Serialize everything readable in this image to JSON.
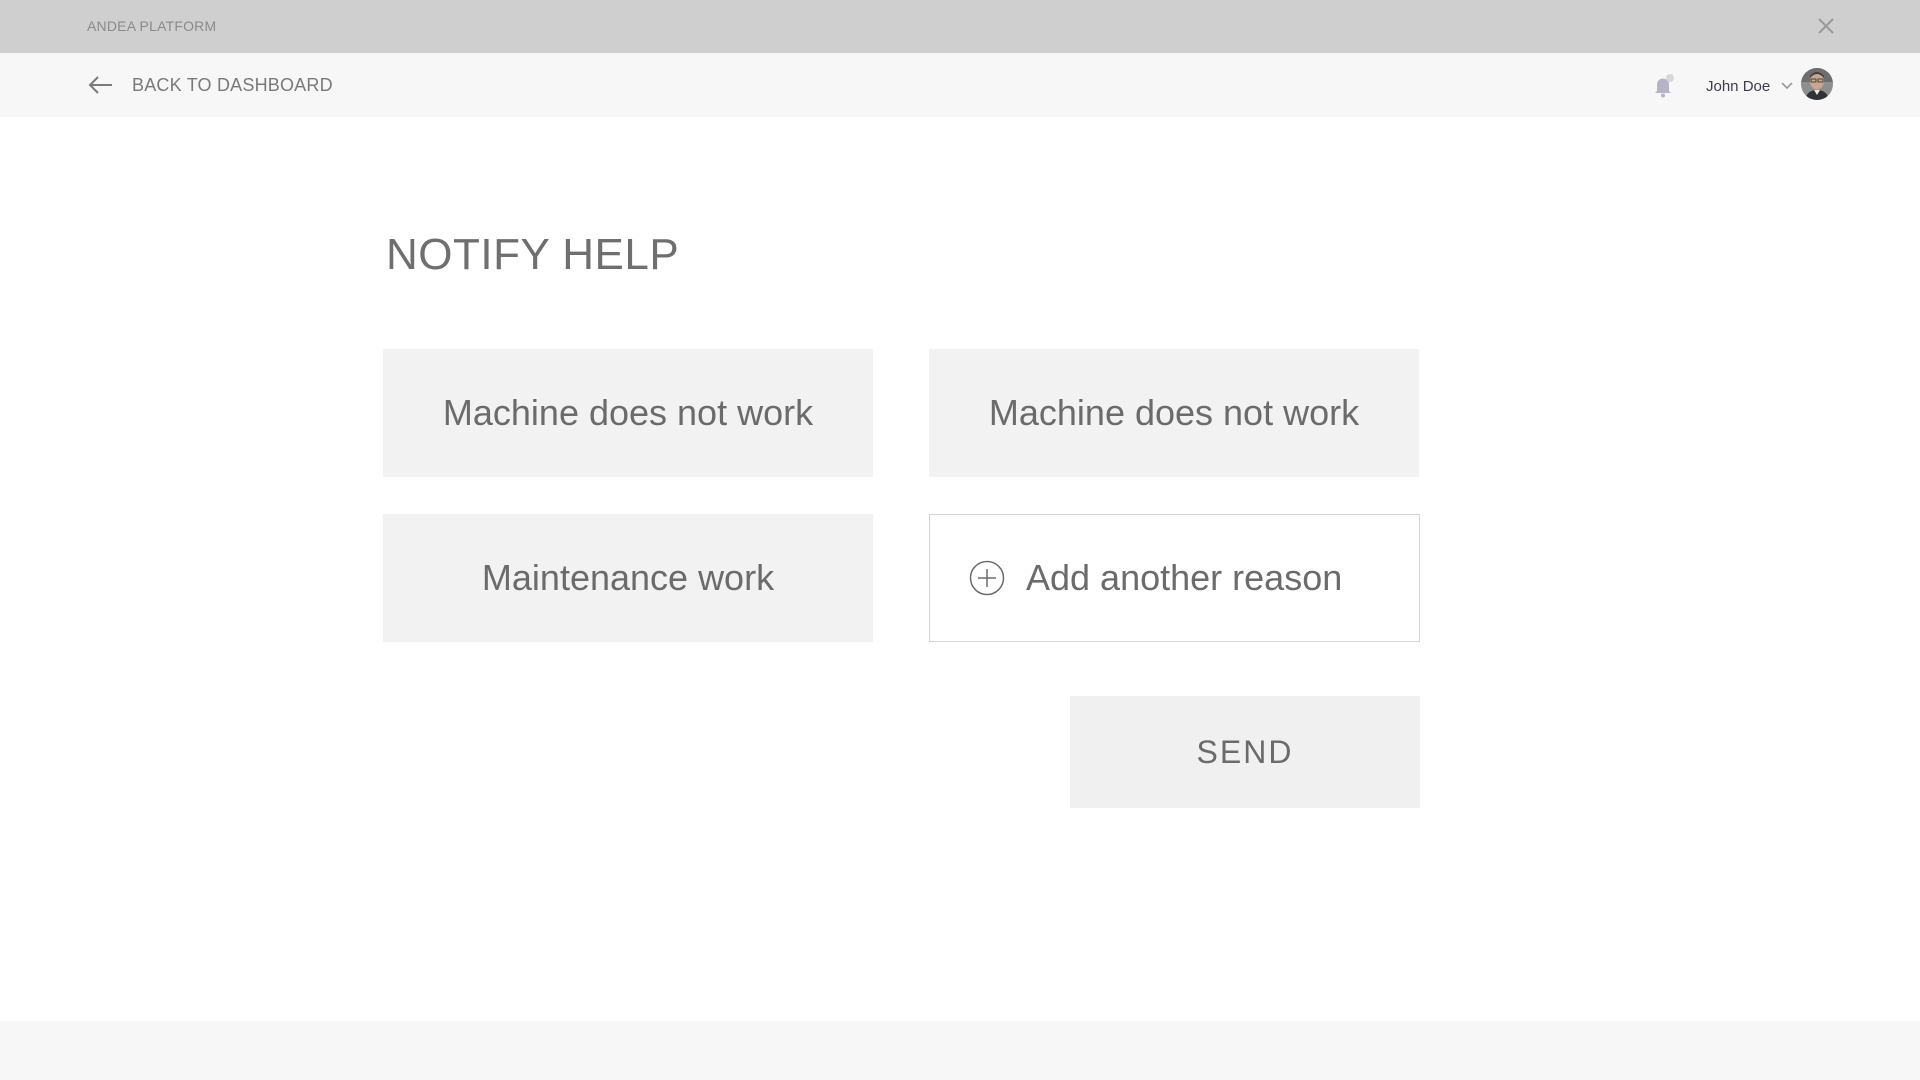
{
  "app": {
    "title": "ANDEA PLATFORM",
    "close_icon": "close-icon"
  },
  "nav": {
    "back_label": "BACK TO DASHBOARD",
    "back_icon": "arrow-left-icon",
    "notification_icon": "bell-icon",
    "user_name": "John Doe",
    "user_menu_icon": "chevron-down-icon"
  },
  "main": {
    "title": "NOTIFY HELP",
    "reasons": [
      {
        "label": "Machine does not work"
      },
      {
        "label": "Machine does not work"
      },
      {
        "label": "Maintenance work"
      }
    ],
    "add_reason": {
      "label": "Add another reason",
      "icon": "plus-circle-icon"
    },
    "send_label": "SEND"
  },
  "colors": {
    "titlebar_bg": "#cfcfcf",
    "navbar_bg": "#f7f7f7",
    "card_bg": "#f2f2f2",
    "text": "#6f6f6f"
  }
}
